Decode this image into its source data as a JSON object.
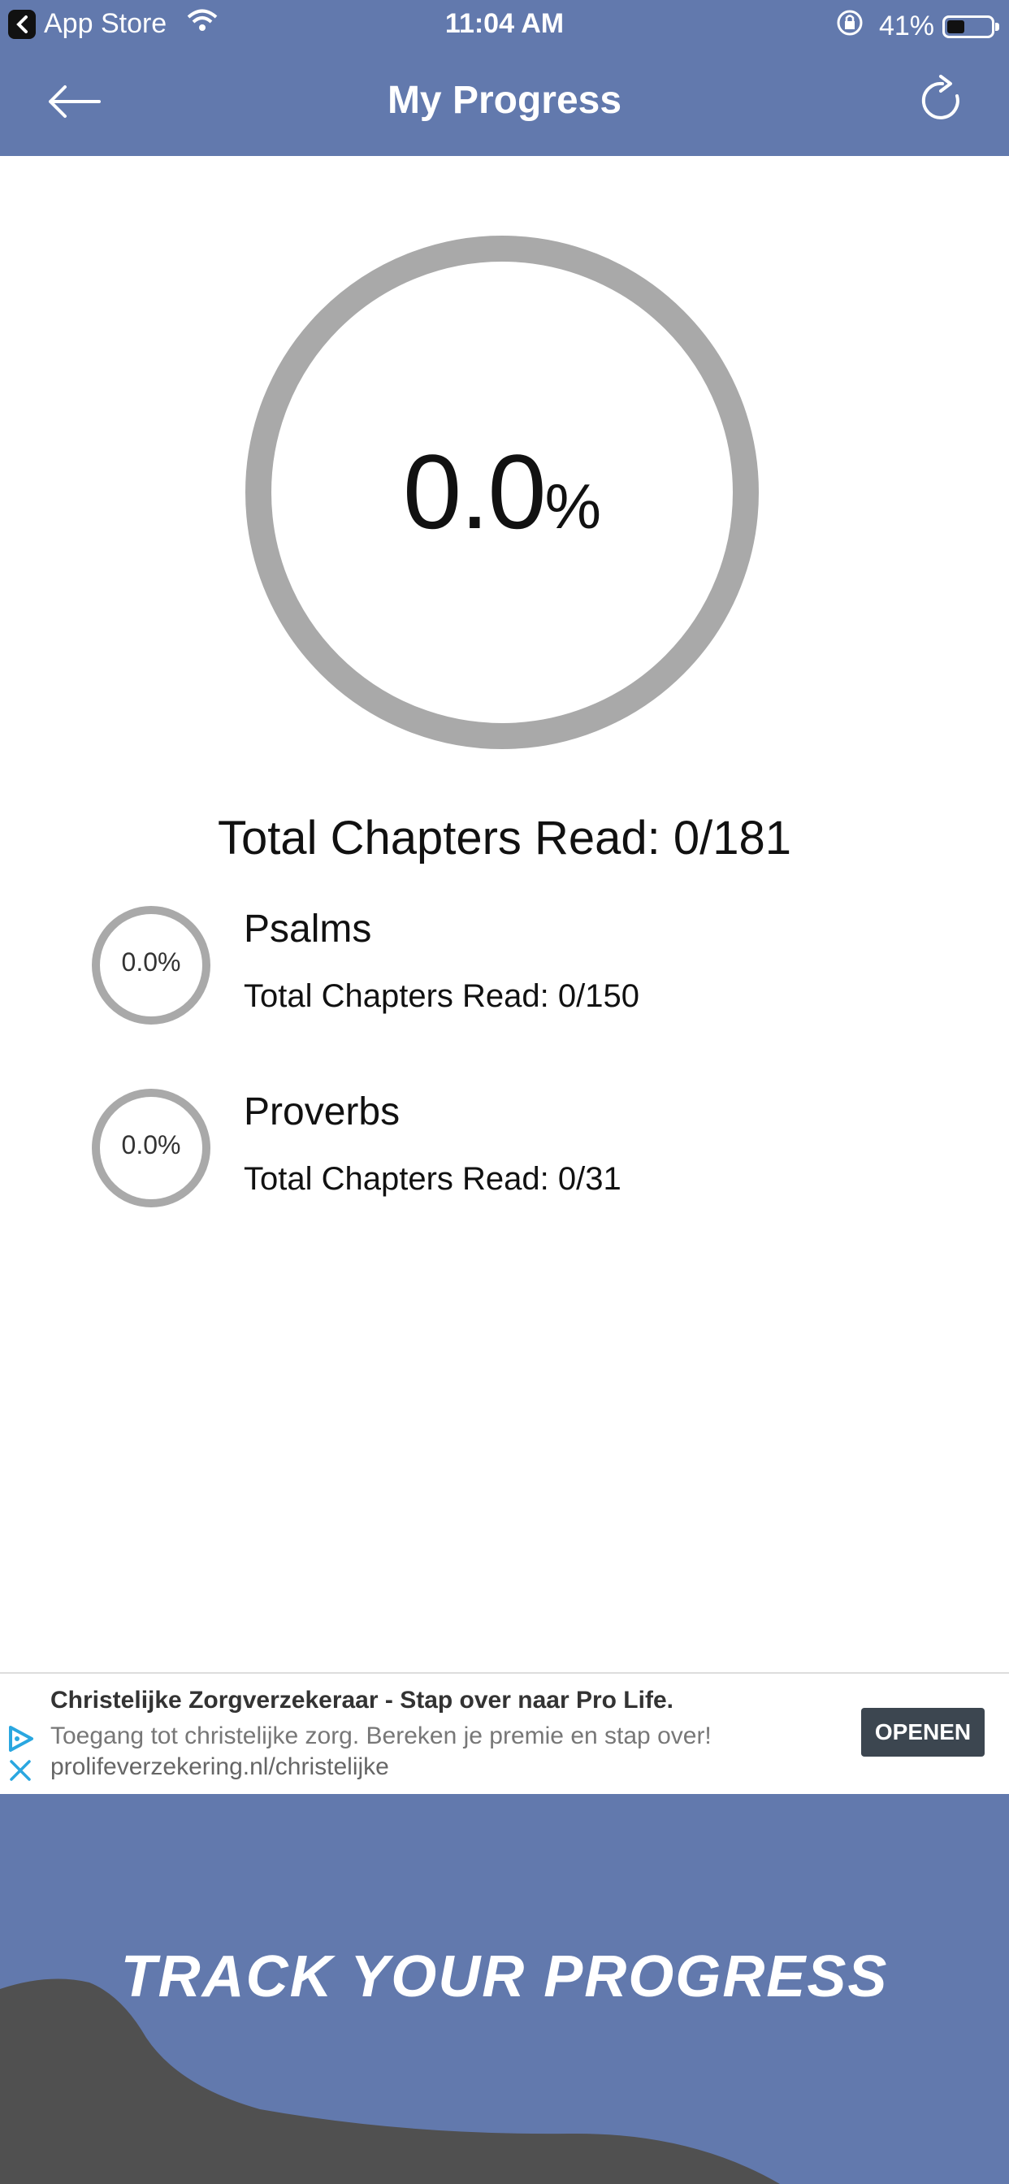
{
  "status_bar": {
    "back_app_label": "App Store",
    "time": "11:04 AM",
    "battery_percent": "41%",
    "battery_level": 0.41
  },
  "nav": {
    "title": "My Progress",
    "back_icon": "arrow-left-icon",
    "refresh_icon": "refresh-icon"
  },
  "overall": {
    "percent_value": "0.0",
    "percent_sign": "%",
    "progress": 0,
    "total_label": "Total Chapters Read: 0/181"
  },
  "books": [
    {
      "name": "Psalms",
      "percent": "0.0%",
      "progress": 0,
      "chapters_label": "Total Chapters Read: 0/150"
    },
    {
      "name": "Proverbs",
      "percent": "0.0%",
      "progress": 0,
      "chapters_label": "Total Chapters Read: 0/31"
    }
  ],
  "ad": {
    "title": "Christelijke Zorgverzekeraar - Stap over naar Pro Life.",
    "description": "Toegang tot christelijke zorg. Bereken je premie en stap over!",
    "url": "prolifeverzekering.nl/christelijke",
    "button_label": "OPENEN"
  },
  "promo": {
    "headline": "TRACK YOUR PROGRESS"
  },
  "colors": {
    "header_blue": "#6279ad",
    "ring_gray": "#a9a9a9",
    "wave_dark": "#505050"
  }
}
